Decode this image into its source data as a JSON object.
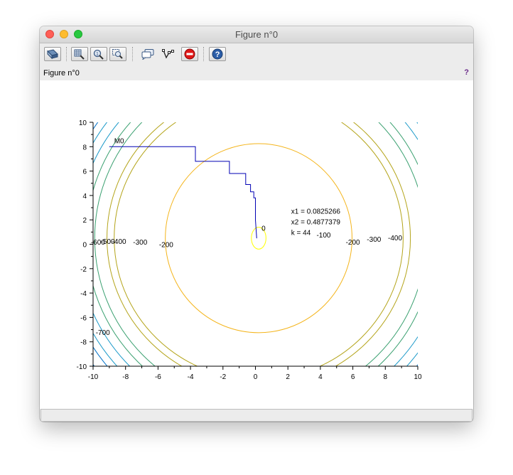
{
  "window": {
    "title": "Figure n°0",
    "figure_label": "Figure n°0",
    "help_glyph": "?"
  },
  "toolbar": {
    "buttons": [
      {
        "name": "rotate-tool-button",
        "icon": "rotate-icon"
      },
      {
        "name": "zoom-grid-button",
        "icon": "zoom-grid-icon"
      },
      {
        "name": "zoom-in-button",
        "icon": "zoom-in-icon"
      },
      {
        "name": "zoom-area-button",
        "icon": "zoom-area-icon"
      },
      {
        "name": "datatip-button",
        "icon": "speech-bubble-icon"
      },
      {
        "name": "datatip-edit-button",
        "icon": "datatip-icon"
      },
      {
        "name": "stop-button",
        "icon": "stop-icon"
      },
      {
        "name": "help-button",
        "icon": "question-icon"
      }
    ]
  },
  "chart_data": {
    "type": "line",
    "xlim": [
      -10,
      10
    ],
    "ylim": [
      -10,
      10
    ],
    "xticks": [
      -10,
      -8,
      -6,
      -4,
      -2,
      0,
      2,
      4,
      6,
      8,
      10
    ],
    "yticks": [
      -10,
      -8,
      -6,
      -4,
      -2,
      0,
      2,
      4,
      6,
      8,
      10
    ],
    "contour_levels": [
      {
        "level": "0",
        "color": "#ffff00"
      },
      {
        "level": "-100",
        "color": "#f4b41a"
      },
      {
        "level": "-200",
        "color": "#b4a41a"
      },
      {
        "level": "-300",
        "color": "#3aa070"
      },
      {
        "level": "-400",
        "color": "#1898c8"
      },
      {
        "level": "-500",
        "color": "#0070c8"
      },
      {
        "level": "-600",
        "color": "#1040a0"
      },
      {
        "level": "-700",
        "color": "#2a1460"
      }
    ],
    "contour_labels": [
      {
        "text": "0",
        "x": 0.5,
        "y": 1.35
      },
      {
        "text": "-100",
        "x": 4.2,
        "y": 0.8
      },
      {
        "text": "-200",
        "x": -5.5,
        "y": 0.0
      },
      {
        "text": "-200",
        "x": 6.0,
        "y": 0.2
      },
      {
        "text": "-300",
        "x": -7.1,
        "y": 0.2
      },
      {
        "text": "-300",
        "x": 7.3,
        "y": 0.45
      },
      {
        "text": "-400",
        "x": -8.4,
        "y": 0.25
      },
      {
        "text": "-400",
        "x": 8.6,
        "y": 0.55
      },
      {
        "text": "-500",
        "x": -9.1,
        "y": 0.25
      },
      {
        "text": "-600",
        "x": -9.7,
        "y": 0.2
      },
      {
        "text": "-700",
        "x": -9.4,
        "y": -7.2
      }
    ],
    "path": {
      "color": "#0000b4",
      "x": [
        -9,
        -3.7,
        -3.7,
        -1.6,
        -1.6,
        -0.6,
        -0.6,
        -0.3,
        -0.3,
        -0.1,
        -0.1,
        0.0,
        0.0,
        0.08
      ],
      "y": [
        8.0,
        8.0,
        6.8,
        6.8,
        5.8,
        5.8,
        4.9,
        4.9,
        4.3,
        4.3,
        3.8,
        3.8,
        2.0,
        0.49
      ]
    },
    "start_label": {
      "text": "M0",
      "x": -8.7,
      "y": 8.5
    },
    "result_lines": [
      "x1 = 0.0825266",
      "x2 = 0.4877379",
      "k = 44"
    ]
  }
}
